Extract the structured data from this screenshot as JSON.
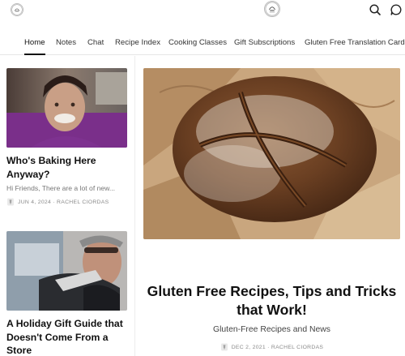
{
  "header": {
    "logo_icon": "publication-logo-icon",
    "actions": [
      {
        "icon": "search-icon"
      },
      {
        "icon": "chat-bubble-icon"
      }
    ]
  },
  "nav": {
    "items": [
      {
        "label": "Home",
        "active": true
      },
      {
        "label": "Notes"
      },
      {
        "label": "Chat"
      },
      {
        "label": "Recipe Index"
      },
      {
        "label": "Cooking Classes"
      },
      {
        "label": "Gift Subscriptions"
      },
      {
        "label": "Gluten Free Translation Cards"
      }
    ]
  },
  "posts": [
    {
      "title": "Who's Baking Here Anyway?",
      "excerpt": "Hi Friends, There are a lot of new...",
      "date": "JUN 4, 2024",
      "author": "RACHEL CIORDAS",
      "meta": "JUN 4, 2024 · RACHEL CIORDAS",
      "image_icon": "author-portrait-photo"
    },
    {
      "title": "A Holiday Gift Guide that Doesn't Come From a Store",
      "image_icon": "gift-guide-photo"
    }
  ],
  "featured": {
    "title": "Gluten Free Recipes, Tips and Tricks that Work!",
    "subtitle": "Gluten-Free Recipes and News",
    "date": "DEC 2, 2021",
    "author": "RACHEL CIORDAS",
    "meta": "DEC 2, 2021 · RACHEL CIORDAS",
    "image_icon": "sourdough-bread-photo"
  },
  "colors": {
    "text": "#1a1a1a",
    "muted": "#8a8a8a",
    "divider": "#e6e6e6",
    "accent": "#111111"
  }
}
